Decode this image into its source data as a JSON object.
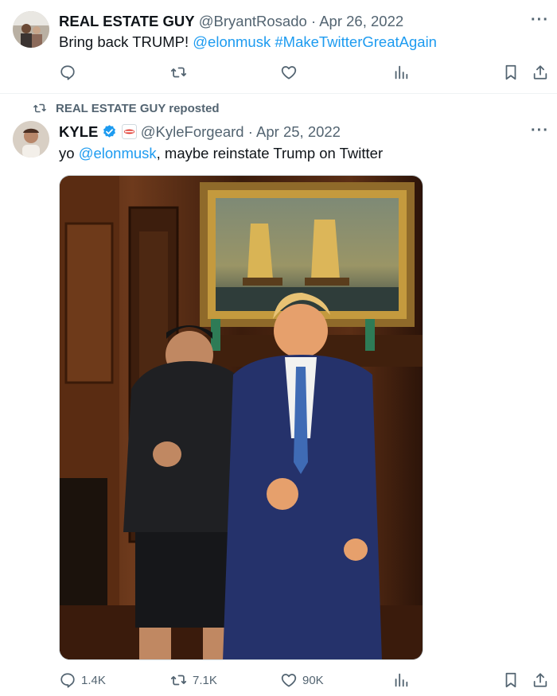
{
  "tweet1": {
    "name": "REAL ESTATE GUY",
    "handle": "@BryantRosado",
    "date": "· Apr 26, 2022",
    "text_prefix": "Bring back TRUMP! ",
    "mention": "@elonmusk",
    "hashtag": "#MakeTwitterGreatAgain",
    "more": "···"
  },
  "repost": {
    "label": "REAL ESTATE GUY reposted"
  },
  "tweet2": {
    "name": "KYLE",
    "handle": "@KyleForgeard",
    "date": "· Apr 25, 2022",
    "text_prefix": "yo ",
    "mention": "@elonmusk",
    "text_suffix": ", maybe reinstate Trump on Twitter",
    "more": "···",
    "stats": {
      "replies": "1.4K",
      "reposts": "7.1K",
      "likes": "90K"
    }
  },
  "colors": {
    "accent": "#1d9bf0",
    "muted": "#536471",
    "text": "#0f1419"
  },
  "icons": [
    "reply-icon",
    "repost-icon",
    "like-icon",
    "views-icon",
    "bookmark-icon",
    "share-icon",
    "verified-icon",
    "more-icon"
  ]
}
